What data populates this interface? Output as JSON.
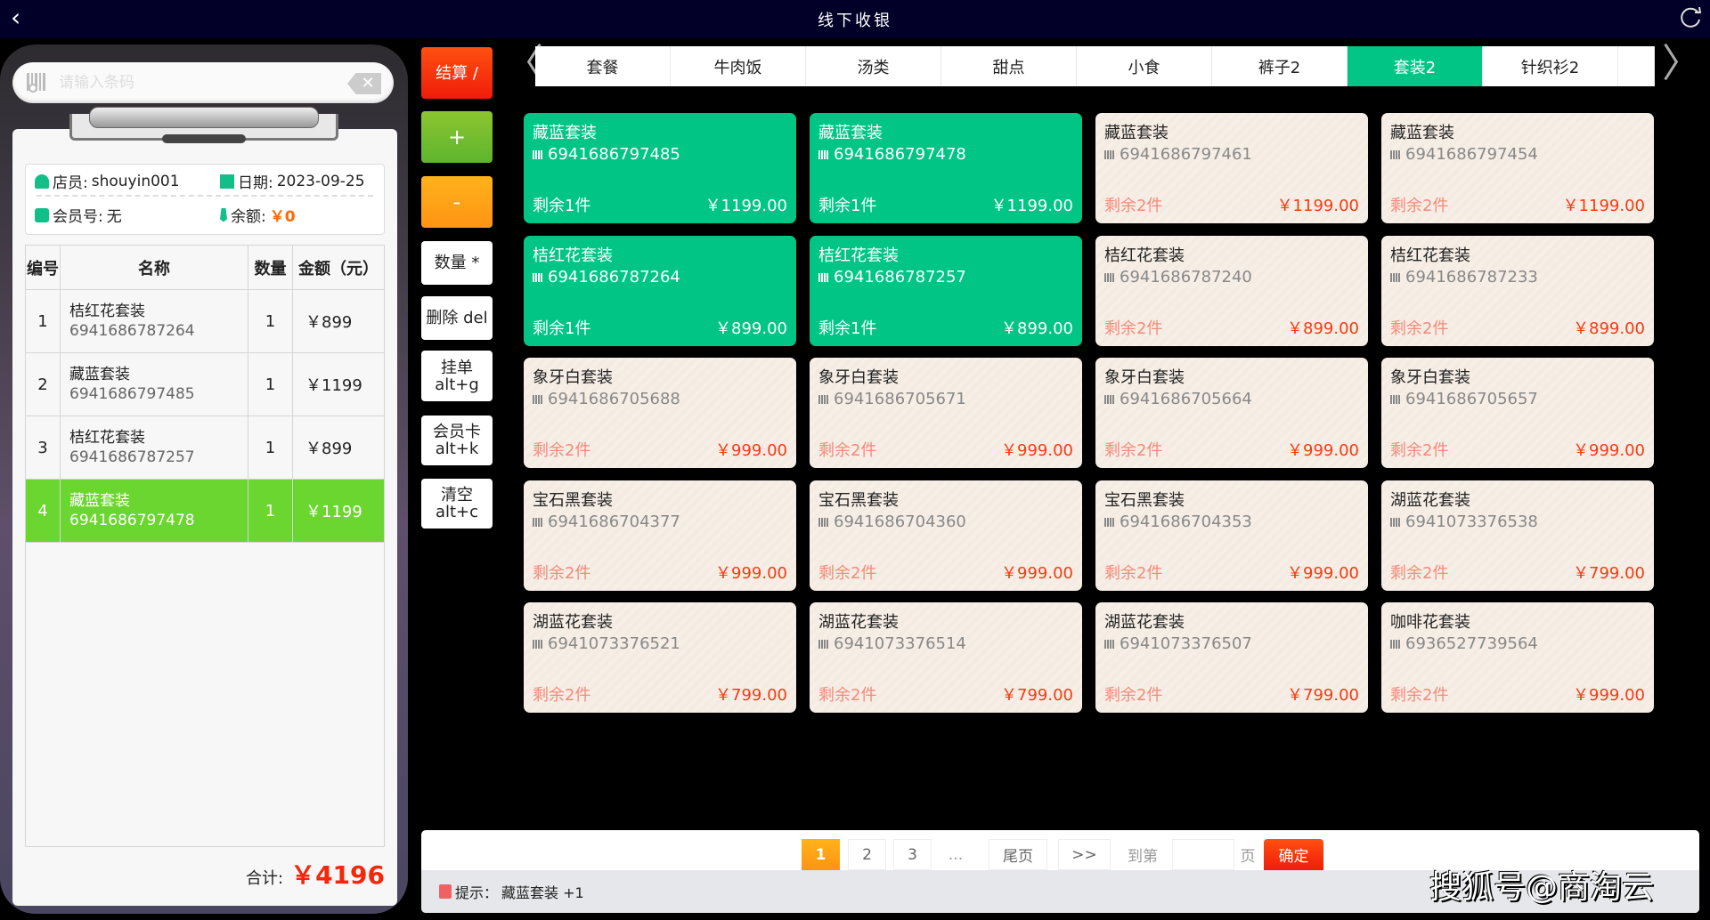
{
  "header": {
    "title": "线下收银",
    "back_icon": "chevron-left-icon",
    "refresh_icon": "refresh-icon"
  },
  "search": {
    "placeholder": "请输入条码",
    "value": ""
  },
  "info": {
    "clerk_label": "店员:",
    "clerk": "shouyin001",
    "date_label": "日期:",
    "date": "2023-09-25",
    "member_label": "会员号:",
    "member": "无",
    "balance_label": "余额:",
    "balance": "￥0"
  },
  "table": {
    "headers": [
      "编号",
      "名称",
      "数量",
      "金额（元）"
    ],
    "rows": [
      {
        "no": "1",
        "name": "桔红花套装",
        "code": "6941686787264",
        "qty": "1",
        "amount": "￥899",
        "selected": false
      },
      {
        "no": "2",
        "name": "藏蓝套装",
        "code": "6941686797485",
        "qty": "1",
        "amount": "￥1199",
        "selected": false
      },
      {
        "no": "3",
        "name": "桔红花套装",
        "code": "6941686787257",
        "qty": "1",
        "amount": "￥899",
        "selected": false
      },
      {
        "no": "4",
        "name": "藏蓝套装",
        "code": "6941686797478",
        "qty": "1",
        "amount": "￥1199",
        "selected": true
      }
    ]
  },
  "total": {
    "label": "合计:",
    "amount": "￥4196"
  },
  "actions": {
    "checkout": "结算 /",
    "plus": "+",
    "minus": "-",
    "qty": "数量 *",
    "delete": "删除 del",
    "hold_1": "挂单",
    "hold_2": "alt+g",
    "member_1": "会员卡",
    "member_2": "alt+k",
    "clear_1": "清空",
    "clear_2": "alt+c"
  },
  "colors": {
    "accent": "#00c585",
    "checkout": "#f5260a",
    "plus": "#6ab82e",
    "minus": "#ff9a12",
    "selected_row": "#6ad62f",
    "price": "#f33b12"
  },
  "tabs": [
    "套餐",
    "牛肉饭",
    "汤类",
    "甜点",
    "小食",
    "裤子2",
    "套装2",
    "针织衫2",
    ""
  ],
  "active_tab": 6,
  "products": [
    {
      "name": "藏蓝套装",
      "code": "6941686797485",
      "remain": "剩余1件",
      "price": "￥1199.00",
      "selected": true
    },
    {
      "name": "藏蓝套装",
      "code": "6941686797478",
      "remain": "剩余1件",
      "price": "￥1199.00",
      "selected": true
    },
    {
      "name": "藏蓝套装",
      "code": "6941686797461",
      "remain": "剩余2件",
      "price": "￥1199.00",
      "selected": false
    },
    {
      "name": "藏蓝套装",
      "code": "6941686797454",
      "remain": "剩余2件",
      "price": "￥1199.00",
      "selected": false
    },
    {
      "name": "桔红花套装",
      "code": "6941686787264",
      "remain": "剩余1件",
      "price": "￥899.00",
      "selected": true
    },
    {
      "name": "桔红花套装",
      "code": "6941686787257",
      "remain": "剩余1件",
      "price": "￥899.00",
      "selected": true
    },
    {
      "name": "桔红花套装",
      "code": "6941686787240",
      "remain": "剩余2件",
      "price": "￥899.00",
      "selected": false
    },
    {
      "name": "桔红花套装",
      "code": "6941686787233",
      "remain": "剩余2件",
      "price": "￥899.00",
      "selected": false
    },
    {
      "name": "象牙白套装",
      "code": "6941686705688",
      "remain": "剩余2件",
      "price": "￥999.00",
      "selected": false
    },
    {
      "name": "象牙白套装",
      "code": "6941686705671",
      "remain": "剩余2件",
      "price": "￥999.00",
      "selected": false
    },
    {
      "name": "象牙白套装",
      "code": "6941686705664",
      "remain": "剩余2件",
      "price": "￥999.00",
      "selected": false
    },
    {
      "name": "象牙白套装",
      "code": "6941686705657",
      "remain": "剩余2件",
      "price": "￥999.00",
      "selected": false
    },
    {
      "name": "宝石黑套装",
      "code": "6941686704377",
      "remain": "剩余2件",
      "price": "￥999.00",
      "selected": false
    },
    {
      "name": "宝石黑套装",
      "code": "6941686704360",
      "remain": "剩余2件",
      "price": "￥999.00",
      "selected": false
    },
    {
      "name": "宝石黑套装",
      "code": "6941686704353",
      "remain": "剩余2件",
      "price": "￥999.00",
      "selected": false
    },
    {
      "name": "湖蓝花套装",
      "code": "6941073376538",
      "remain": "剩余2件",
      "price": "￥799.00",
      "selected": false
    },
    {
      "name": "湖蓝花套装",
      "code": "6941073376521",
      "remain": "剩余2件",
      "price": "￥799.00",
      "selected": false
    },
    {
      "name": "湖蓝花套装",
      "code": "6941073376514",
      "remain": "剩余2件",
      "price": "￥799.00",
      "selected": false
    },
    {
      "name": "湖蓝花套装",
      "code": "6941073376507",
      "remain": "剩余2件",
      "price": "￥799.00",
      "selected": false
    },
    {
      "name": "咖啡花套装",
      "code": "6936527739564",
      "remain": "剩余2件",
      "price": "￥999.00",
      "selected": false
    }
  ],
  "pagination": {
    "pages": [
      "1",
      "2",
      "3"
    ],
    "current": "1",
    "ellipsis": "...",
    "last": "尾页",
    "next": ">>",
    "goto_label": "到第",
    "goto_value": "",
    "page_label": "页",
    "confirm": "确定"
  },
  "hint": {
    "label": "提示：",
    "text": "藏蓝套装 +1"
  },
  "watermark": "搜狐号@商淘云"
}
